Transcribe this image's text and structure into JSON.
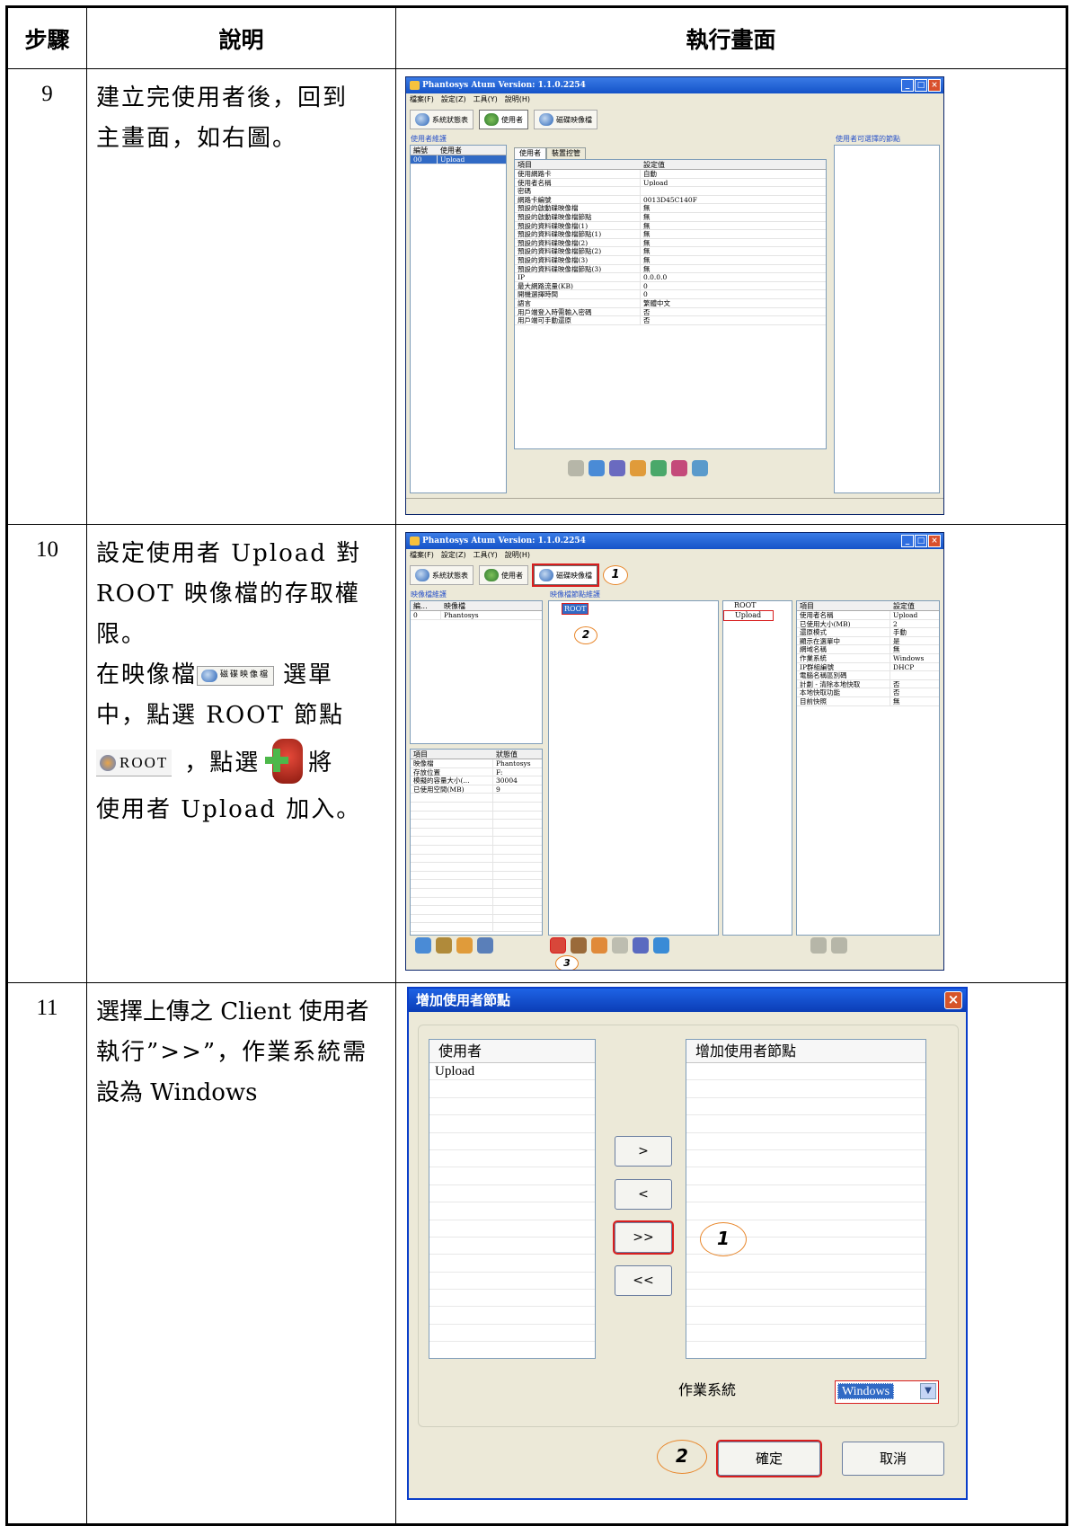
{
  "headers": {
    "step": "步驟",
    "desc": "說明",
    "screen": "執行畫面"
  },
  "rows": [
    {
      "step": "9",
      "lines": [
        "建立完使用者後，回到",
        "主畫面，如右圖。"
      ]
    },
    {
      "step": "10",
      "lines": [
        "設定使用者 Upload 對",
        "ROOT 映像檔的存取權",
        "限。"
      ],
      "line4a": "在映像檔",
      "line4_btn": "磁碟映像檔",
      "line4b": "選單",
      "line5": "中，點選 ROOT 節點",
      "line6_root": "ROOT",
      "line6b": "，點選",
      "line6c": "將",
      "line7": "使用者 Upload 加入。"
    },
    {
      "step": "11",
      "lines": [
        "選擇上傳之 Client 使用者",
        "執行”>>”，作業系統需",
        "設為 Windows"
      ]
    }
  ],
  "app": {
    "title": "Phantosys Atum Version: 1.1.0.2254",
    "menu": [
      "檔案(F)",
      "設定(Z)",
      "工具(Y)",
      "說明(H)"
    ],
    "toolbar": [
      "系統狀態表",
      "使用者",
      "磁碟映像檔"
    ]
  },
  "win1": {
    "left_title": "使用者維護",
    "left_cols": [
      "編號",
      "使用者"
    ],
    "left_row": [
      "00",
      "Upload"
    ],
    "tabs": [
      "使用者",
      "裝置控管"
    ],
    "prop_cols": [
      "項目",
      "設定值"
    ],
    "props": [
      [
        "使用網路卡",
        "自動"
      ],
      [
        "使用者名稱",
        "Upload"
      ],
      [
        "密碼",
        ""
      ],
      [
        "網路卡編號",
        "0013D45C140F"
      ],
      [
        "預設的啟動碟映像檔",
        "無"
      ],
      [
        "預設的啟動碟映像檔節點",
        "無"
      ],
      [
        "預設的資料碟映像檔(1)",
        "無"
      ],
      [
        "預設的資料碟映像檔節點(1)",
        "無"
      ],
      [
        "預設的資料碟映像檔(2)",
        "無"
      ],
      [
        "預設的資料碟映像檔節點(2)",
        "無"
      ],
      [
        "預設的資料碟映像檔(3)",
        "無"
      ],
      [
        "預設的資料碟映像檔節點(3)",
        "無"
      ],
      [
        "IP",
        "0.0.0.0"
      ],
      [
        "最大網路流量(KB)",
        "0"
      ],
      [
        "開機選擇時間",
        "0"
      ],
      [
        "語言",
        "繁體中文"
      ],
      [
        "用戶端登入時需輸入密碼",
        "否"
      ],
      [
        "用戶端可手動還原",
        "否"
      ]
    ],
    "right_title": "使用者可選擇的節點"
  },
  "win2": {
    "left_title": "映像檔維護",
    "left_cols": [
      "編...",
      "映像檔"
    ],
    "left_row": [
      "0",
      "Phantosys"
    ],
    "mid_title": "映像檔節點維護",
    "root_node": "ROOT",
    "tree_items": [
      "ROOT",
      "Upload"
    ],
    "info_cols": [
      "項目",
      "狀態值"
    ],
    "info": [
      [
        "映像檔",
        "Phantosys"
      ],
      [
        "存放位置",
        "F:"
      ],
      [
        "模擬的容量大小(...",
        "30004"
      ],
      [
        "已使用空間(MB)",
        "9"
      ]
    ],
    "prop_cols": [
      "項目",
      "設定值"
    ],
    "props": [
      [
        "使用者名稱",
        "Upload"
      ],
      [
        "已使用大小(MB)",
        "2"
      ],
      [
        "還原模式",
        "手動"
      ],
      [
        "顯示在選單中",
        "是"
      ],
      [
        "網域名稱",
        "無"
      ],
      [
        "作業系統",
        "Windows"
      ],
      [
        "IP群組編號",
        "DHCP"
      ],
      [
        "電腦名稱區別碼",
        ""
      ],
      [
        "計劃 - 清除本地快取",
        "否"
      ],
      [
        "本地快取功能",
        "否"
      ],
      [
        "目前快照",
        "無"
      ]
    ],
    "marks": [
      "1",
      "2",
      "3"
    ]
  },
  "dialog": {
    "title": "增加使用者節點",
    "left_header": "使用者",
    "left_items": [
      "Upload"
    ],
    "right_header": "增加使用者節點",
    "buttons": [
      ">",
      "<",
      ">>",
      "<<"
    ],
    "os_label": "作業系統",
    "os_value": "Windows",
    "ok": "確定",
    "cancel": "取消",
    "marks": [
      "1",
      "2"
    ]
  }
}
